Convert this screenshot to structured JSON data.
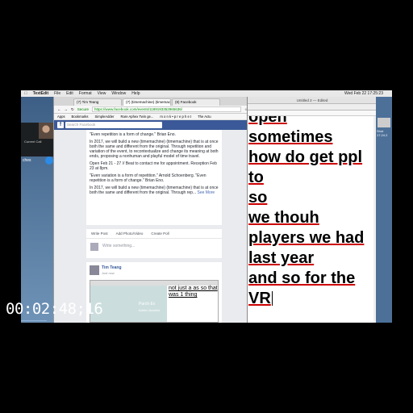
{
  "menubar": {
    "app": "TextEdit",
    "items": [
      "File",
      "Edit",
      "Format",
      "View",
      "Window",
      "Help"
    ],
    "clock": "Wed Feb 22  17:25:23"
  },
  "call": {
    "label": "Current Call",
    "side_text": "ches"
  },
  "browser": {
    "tabs": [
      "(7) Tim Teang",
      "(7) (timemachine) (timemachi",
      "(8) Facebook"
    ],
    "secure_label": "Secure",
    "url": "https://www.facebook.com/events/1189193352965636/",
    "bookmarks": [
      "Apps",
      "Bookmarks",
      "SimpleAdder",
      "Rare Aphex Twin ge...",
      "m o n k • p r e p h e t",
      "The Actu"
    ],
    "search_placeholder": "Search Facebook"
  },
  "post1": {
    "lines": [
      "\"Even repetition is a form of change.\" Brian Eno.",
      "In 2017, we will build a new (timemachine) (timemachine) that is at once both the same and different from the original. Through repetition and variation of the event, to recontextualize and change its meaning at both ends, proposing a nonhuman and playful model of time travel.",
      "Open Feb 21 - 27 // Beat to contact me for appointment. Reception Feb 23 at 8pm.",
      "\"Even variation is a form of repetition.\" Arnold Schoenberg. \"Even repetition is a form of change.\" Brian Eno.",
      "In 2017, we will build a new (timemachine) (timemachine) that is at once both the same and different from the original. Through rep..."
    ],
    "see_more": "See More"
  },
  "composer": {
    "write_post": "Write Post",
    "add_photo": "Add Photo/Video",
    "create_poll": "Create Poll",
    "placeholder": "Write something..."
  },
  "post2": {
    "author": "Tim Teang",
    "time": "Just now",
    "shot_text": "not just a as so that was 1 thing",
    "shot_label": "Parch Ex",
    "shot_label2": "Adrien Azzolini"
  },
  "textedit": {
    "title": "Untitled 2 — Edited",
    "lines": [
      "open",
      "sometimes",
      "how do get ppl",
      "to",
      "so",
      "we thouh",
      "players we had",
      "last year",
      "and so for the",
      "VR"
    ]
  },
  "desktop_right": {
    "label": "Shot 17.24.2"
  },
  "overlay": {
    "timecode": "00:02:48;16"
  },
  "colors": {
    "facebook_blue": "#3b5998",
    "desktop": "#5b7fa6",
    "misspell_underline": "#cc0000",
    "hangup_red": "#e0302a",
    "mute_blue": "#2b8be6"
  }
}
